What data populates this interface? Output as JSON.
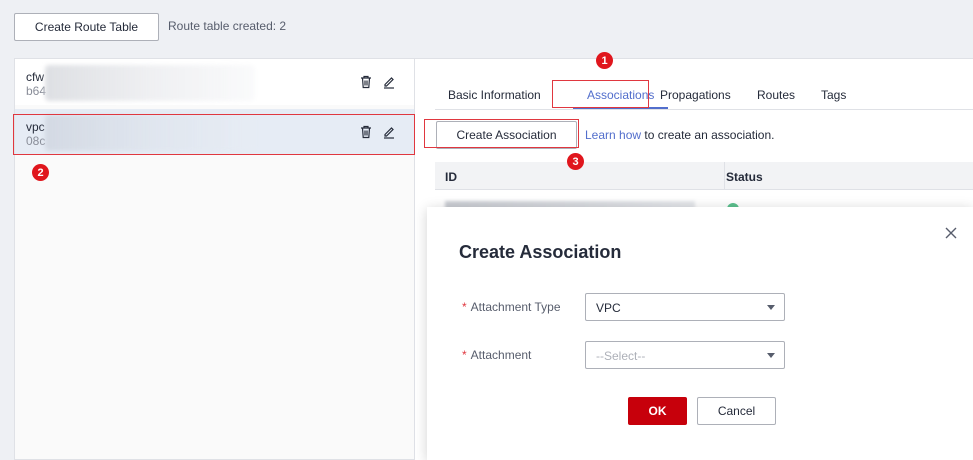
{
  "toolbar": {
    "create_route_table_label": "Create Route Table",
    "route_table_count": "Route table created: 2"
  },
  "route_tables": [
    {
      "name": "cfw",
      "id": "b64"
    },
    {
      "name": "vpc",
      "id": "08c"
    }
  ],
  "annotations": {
    "step1": "1",
    "step2": "2",
    "step3": "3"
  },
  "tabs": [
    {
      "label": "Basic Information"
    },
    {
      "label": "Associations"
    },
    {
      "label": "Propagations"
    },
    {
      "label": "Routes"
    },
    {
      "label": "Tags"
    }
  ],
  "associations": {
    "create_label": "Create Association",
    "learn_link": "Learn how",
    "learn_suffix": " to create an association.",
    "columns": [
      "ID",
      "Status"
    ]
  },
  "modal": {
    "title": "Create Association",
    "attachment_type_label": "Attachment Type",
    "attachment_type_value": "VPC",
    "attachment_label": "Attachment",
    "attachment_placeholder": "--Select--",
    "required_mark": "*",
    "ok_label": "OK",
    "cancel_label": "Cancel"
  },
  "colors": {
    "accent": "#526ecc",
    "primary_button": "#c7000b",
    "highlight": "#e0373f",
    "status_ok": "#5cc08e"
  },
  "icons": {
    "delete": "trash-icon",
    "edit": "pencil-icon",
    "close": "close-icon",
    "dropdown": "chevron-down-icon"
  }
}
